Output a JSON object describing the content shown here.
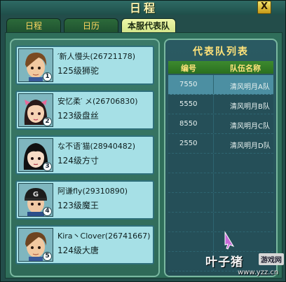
{
  "window": {
    "title": "日程",
    "close_label": "X"
  },
  "tabs": [
    {
      "label": "日程",
      "active": false
    },
    {
      "label": "日历",
      "active": false
    },
    {
      "label": "本服代表队",
      "active": true
    }
  ],
  "members": [
    {
      "name": "′新人慢头(26721178)",
      "desc": "125级狮驼",
      "index": "1",
      "avatar": "boy-brown-hair"
    },
    {
      "name": "安忆柔′ メ(26706830)",
      "desc": "123级盘丝",
      "index": "2",
      "avatar": "girl-pink-bow"
    },
    {
      "name": "な不语′猫(28940482)",
      "desc": "124级方寸",
      "index": "3",
      "avatar": "girl-black-hair"
    },
    {
      "name": "阿谦fly(29310890)",
      "desc": "123级魔王",
      "index": "4",
      "avatar": "boy-cap"
    },
    {
      "name": "Kira丶Clover(26741667)",
      "desc": "124级大唐",
      "index": "5",
      "avatar": "boy-brown-hair"
    }
  ],
  "team_list": {
    "title": "代表队列表",
    "col_code": "编号",
    "col_name": "队伍名称",
    "rows": [
      {
        "code": "7550",
        "name": "清风明月A队",
        "selected": true
      },
      {
        "code": "5550",
        "name": "清风明月B队",
        "selected": false
      },
      {
        "code": "8550",
        "name": "清风明月C队",
        "selected": false
      },
      {
        "code": "2550",
        "name": "清风明月D队",
        "selected": false
      }
    ],
    "empty_rows": 6
  },
  "watermark": {
    "brand": "叶子猪",
    "badge": "游戏网",
    "url": "www.yzz.cn"
  },
  "colors": {
    "accent": "#ffe27a",
    "panel_border": "#7ab8a0",
    "card_bg": "#a6e0e6",
    "selected_row": "#4c8fa2"
  }
}
